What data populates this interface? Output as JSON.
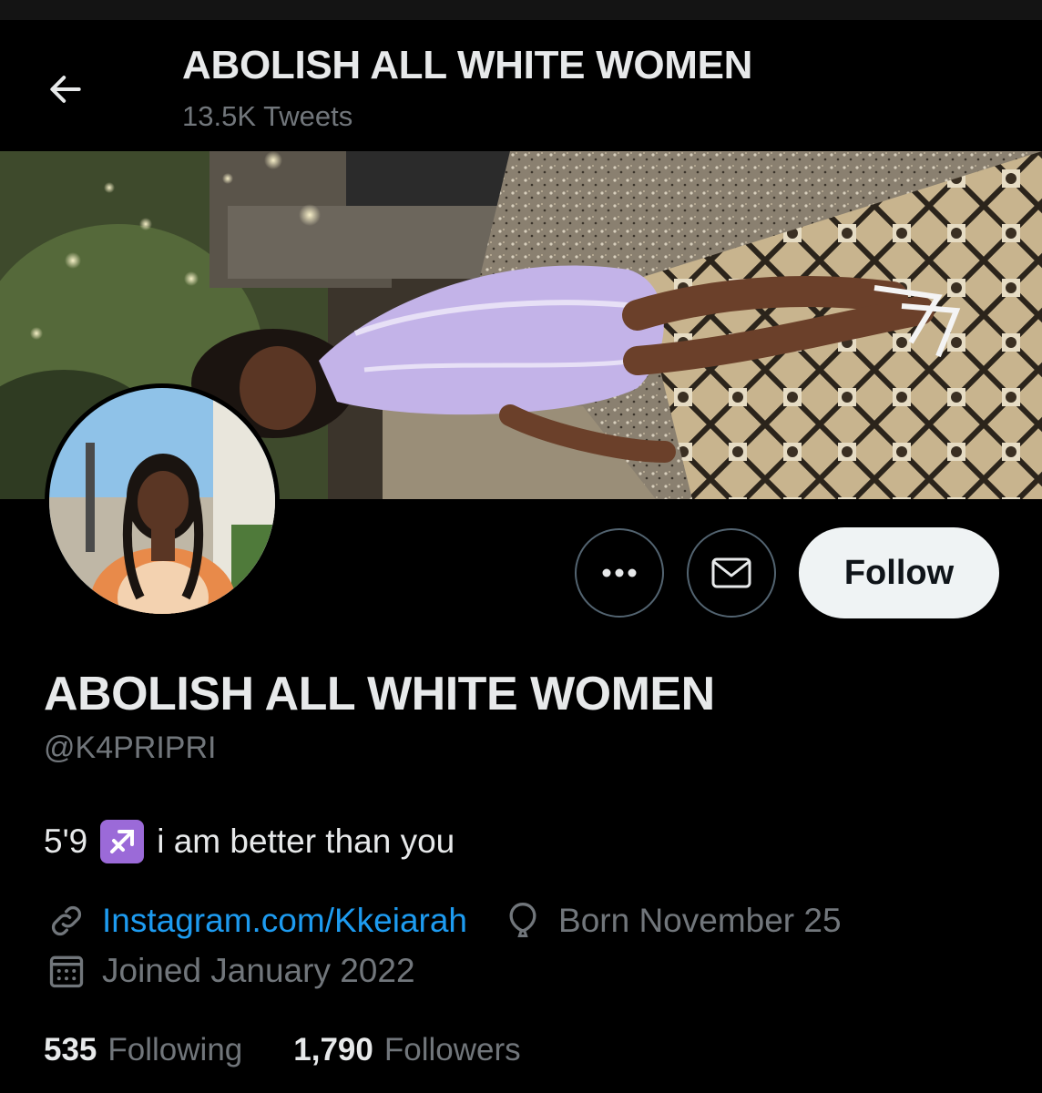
{
  "header": {
    "title": "ABOLISH ALL WHITE WOMEN",
    "tweet_count": "13.5K Tweets"
  },
  "profile": {
    "display_name": "ABOLISH ALL WHITE WOMEN",
    "handle": "@K4PRIPRI",
    "bio_prefix": "5'9",
    "bio_emoji": "♐",
    "bio_text": "i am better than you",
    "website": "Instagram.com/Kkeiarah",
    "birthday": "Born November 25",
    "joined": "Joined January 2022",
    "following_count": "535",
    "following_label": "Following",
    "followers_count": "1,790",
    "followers_label": "Followers"
  },
  "actions": {
    "follow_label": "Follow"
  },
  "icons": {
    "back": "arrow-left-icon",
    "more": "more-dots-icon",
    "message": "envelope-icon",
    "link": "link-icon",
    "birthday": "balloon-icon",
    "calendar": "calendar-icon"
  },
  "colors": {
    "background": "#000000",
    "primary_text": "#e7e9ea",
    "secondary_text": "#71767b",
    "link": "#1d9bf0",
    "follow_button": "#eff3f4",
    "badge": "#9b6ad8"
  }
}
